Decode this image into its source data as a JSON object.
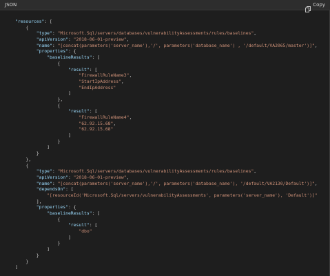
{
  "header": {
    "language_label": "JSON",
    "copy_label": "Copy",
    "copy_icon": "copy-icon"
  },
  "colors": {
    "background": "#1e1e1e",
    "header_background": "#2d2d2d",
    "key": "#9cdcfe",
    "string": "#ce9178",
    "punctuation": "#d4d4d4"
  },
  "code_lines": [
    "\"resources\": [",
    "    {",
    "        \"type\": \"Microsoft.Sql/servers/databases/vulnerabilityAssessments/rules/baselines\",",
    "        \"apiVersion\": \"2018-06-01-preview\",",
    "        \"name\": \"[concat(parameters('server_name'),'/', parameters('database_name') , '/default/VA2065/master')]\",",
    "        \"properties\": {",
    "            \"baselineResults\": [",
    "                {",
    "                    \"result\": [",
    "                        \"FirewallRuleName3\",",
    "                        \"StartIpAddress\",",
    "                        \"EndIpAddress\"",
    "                    ]",
    "                },",
    "                {",
    "                    \"result\": [",
    "                        \"FirewallRuleName4\",",
    "                        \"62.92.15.68\",",
    "                        \"62.92.15.68\"",
    "                    ]",
    "                }",
    "            ]",
    "        }",
    "    },",
    "    {",
    "        \"type\": \"Microsoft.Sql/servers/databases/vulnerabilityAssessments/rules/baselines\",",
    "        \"apiVersion\": \"2018-06-01-preview\",",
    "        \"name\": \"[concat(parameters('server_name'),'/', parameters('database_name'), '/default/VA2130/Default')]\",",
    "        \"dependsOn\": [",
    "            \"[resourceId('Microsoft.Sql/servers/vulnerabilityAssessments', parameters('server_name'), 'Default')]\"",
    "        ],",
    "        \"properties\": {",
    "            \"baselineResults\": [",
    "                {",
    "                    \"result\": [",
    "                        \"dbo\"",
    "                    ]",
    "                }",
    "            ]",
    "        }",
    "    }",
    "]"
  ]
}
